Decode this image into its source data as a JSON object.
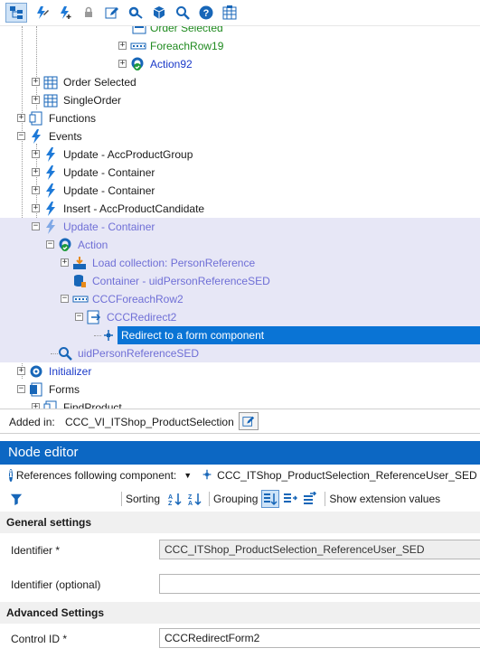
{
  "toolbar": {
    "buttons": [
      "tree-view-icon",
      "lightning-edit-icon",
      "lightning-add-icon",
      "lock-icon",
      "pencil-icon",
      "gear-link-icon",
      "cube-icon",
      "search-icon",
      "help-icon",
      "grid-icon"
    ]
  },
  "tree": {
    "nodes": [
      {
        "label": "Order Selected",
        "style": "green"
      },
      {
        "label": "ForeachRow19",
        "style": "green"
      },
      {
        "label": "Action92",
        "style": "blue"
      },
      {
        "label": "Order Selected",
        "style": "dark"
      },
      {
        "label": "SingleOrder",
        "style": "dark"
      },
      {
        "label": "Functions",
        "style": "dark"
      },
      {
        "label": "Events",
        "style": "dark"
      },
      {
        "label": "Update - AccProductGroup",
        "style": "dark"
      },
      {
        "label": "Update - Container",
        "style": "dark"
      },
      {
        "label": "Update - Container",
        "style": "dark"
      },
      {
        "label": "Insert - AccProductCandidate",
        "style": "dark"
      },
      {
        "label": "Update - Container",
        "style": "muted"
      },
      {
        "label": "Action",
        "style": "muted"
      },
      {
        "label": "Load collection: PersonReference",
        "style": "muted"
      },
      {
        "label": "Container - uidPersonReferenceSED",
        "style": "muted"
      },
      {
        "label": "CCCForeachRow2",
        "style": "muted"
      },
      {
        "label": "CCCRedirect2",
        "style": "muted"
      },
      {
        "label": "Redirect to a form component",
        "style": "selected"
      },
      {
        "label": "uidPersonReferenceSED",
        "style": "muted"
      },
      {
        "label": "Initializer",
        "style": "blue"
      },
      {
        "label": "Forms",
        "style": "dark"
      },
      {
        "label": "FindProduct",
        "style": "dark"
      }
    ]
  },
  "added_in": {
    "label": "Added in:",
    "value": "CCC_VI_ITShop_ProductSelection"
  },
  "node_editor": {
    "title": "Node editor",
    "references_label": "References following component:",
    "reference_value": "CCC_ITShop_ProductSelection_ReferenceUser_SED (R",
    "sorting_label": "Sorting",
    "grouping_label": "Grouping",
    "show_ext_label": "Show extension values",
    "general_settings": "General settings",
    "advanced_settings": "Advanced Settings",
    "identifier_label": "Identifier *",
    "identifier_value": "CCC_ITShop_ProductSelection_ReferenceUser_SED",
    "identifier_optional_label": "Identifier (optional)",
    "identifier_optional_value": "",
    "control_id_label": "Control ID *",
    "control_id_value": "CCCRedirectForm2"
  },
  "colors": {
    "accent": "#0c67c3",
    "selection": "#0a74d5",
    "highlight": "#e7e7f6",
    "green_text": "#1f8a1f",
    "blue_text": "#1a39c9",
    "muted_text": "#6f6fd6"
  }
}
